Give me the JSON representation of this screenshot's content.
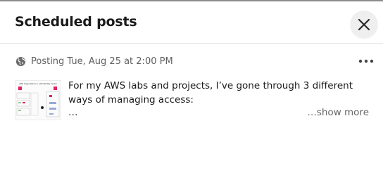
{
  "modal": {
    "title": "Scheduled posts",
    "close_label": "Close",
    "close_icon": "close-icon"
  },
  "post": {
    "visibility_icon": "globe-icon",
    "schedule_text": "Posting Tue, Aug 25 at 2:00 PM",
    "more_icon": "more-horizontal-icon",
    "thumbnail_title": "AWS Organizations + IAM Identity Center",
    "text": "For my AWS labs and projects, I’ve gone through 3 different ways of managing access:",
    "truncated": "…",
    "show_more_label": "…show more"
  },
  "colors": {
    "accent_red": "#e0245e",
    "muted_text": "#5f5f5f",
    "close_bg": "#efefef"
  }
}
